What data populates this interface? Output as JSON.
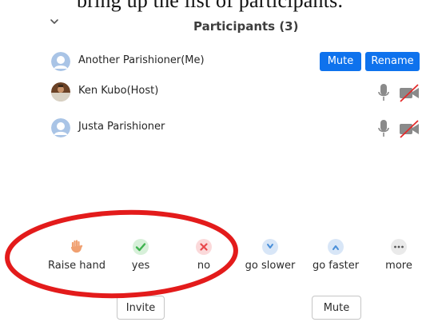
{
  "background_caption": "bring up the list of participants.",
  "panel": {
    "title": "Participants (3)"
  },
  "participants": [
    {
      "name": "Another Parishioner(Me)",
      "buttons": [
        "Mute",
        "Rename"
      ]
    },
    {
      "name": "Ken Kubo(Host)"
    },
    {
      "name": "Justa Parishioner"
    }
  ],
  "reactions": [
    {
      "label": "Raise hand",
      "icon": "raise-hand-icon"
    },
    {
      "label": "yes",
      "icon": "check-icon"
    },
    {
      "label": "no",
      "icon": "x-icon"
    },
    {
      "label": "go slower",
      "icon": "go-slower-icon"
    },
    {
      "label": "go faster",
      "icon": "go-faster-icon"
    },
    {
      "label": "more",
      "icon": "more-icon"
    }
  ],
  "footer": {
    "invite_label": "Invite",
    "mute_label": "Mute"
  },
  "colors": {
    "accent": "#0e72ed",
    "annotation_red": "#e31b1b",
    "yes_green": "#3fb34f",
    "no_red": "#e8474b"
  }
}
